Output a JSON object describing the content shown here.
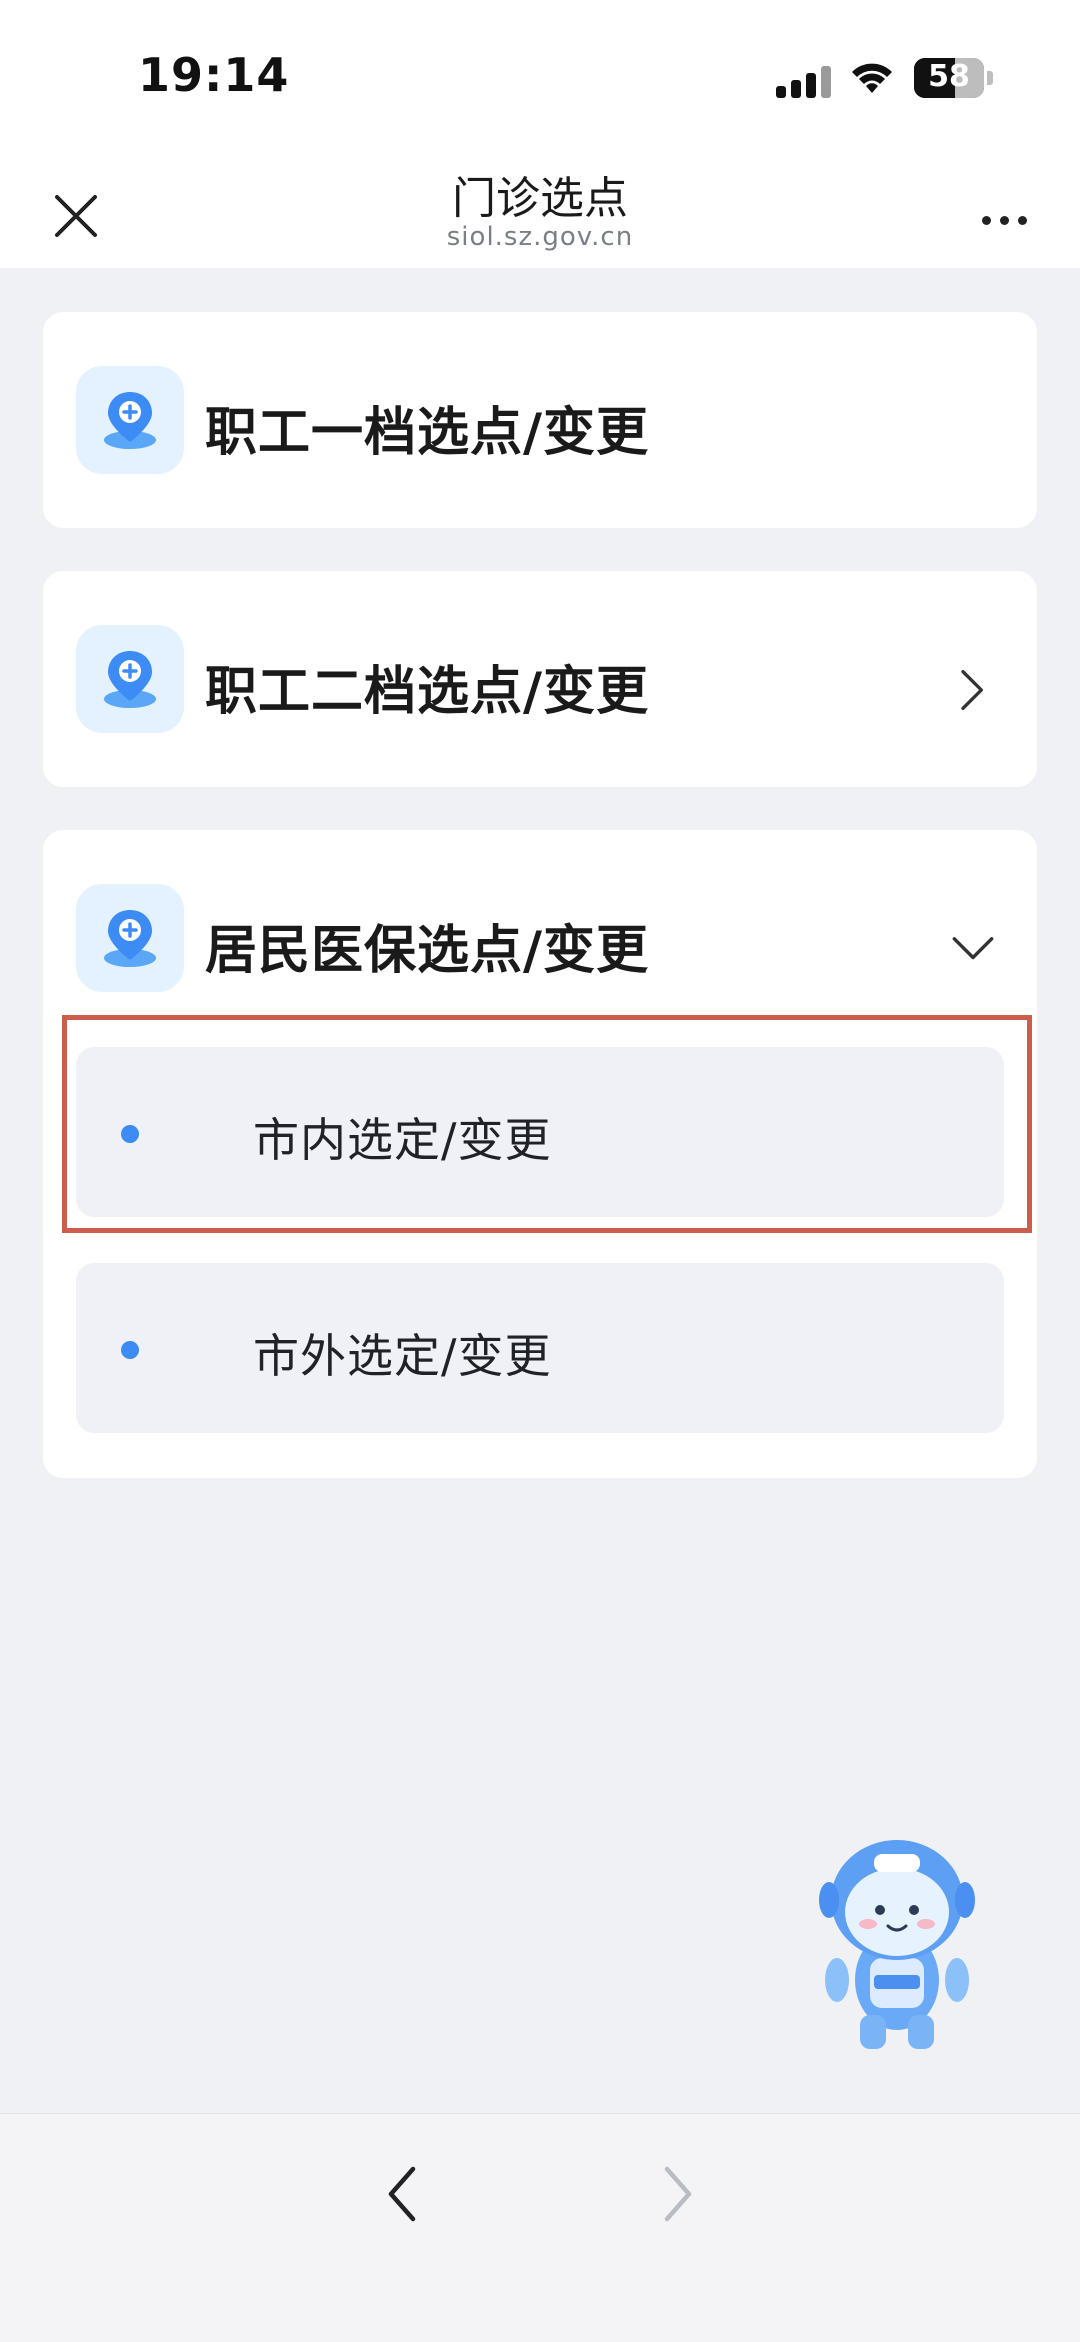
{
  "status_bar": {
    "time": "19:14",
    "battery_level": "58"
  },
  "header": {
    "title": "门诊选点",
    "subtitle": "siol.sz.gov.cn",
    "close_icon": "close-icon",
    "more_icon": "more-dots-icon"
  },
  "cards": [
    {
      "label": "职工一档选点/变更",
      "icon": "location-pin-plus-icon",
      "chevron": "none"
    },
    {
      "label": "职工二档选点/变更",
      "icon": "location-pin-plus-icon",
      "chevron": "right"
    },
    {
      "label": "居民医保选点/变更",
      "icon": "location-pin-plus-icon",
      "chevron": "down",
      "expanded": true,
      "sub_items": [
        {
          "label": "市内选定/变更",
          "highlighted": true
        },
        {
          "label": "市外选定/变更",
          "highlighted": false
        }
      ]
    }
  ],
  "colors": {
    "background": "#eff1f5",
    "card": "#ffffff",
    "icon_tile": "#e4f1ff",
    "icon_blue": "#3d8bf5",
    "highlight_border": "#cc5c4c"
  },
  "mascot": "assistant-robot-mascot",
  "bottom_nav": {
    "back_icon": "chevron-left-icon",
    "forward_icon": "chevron-right-icon",
    "forward_enabled": false
  }
}
